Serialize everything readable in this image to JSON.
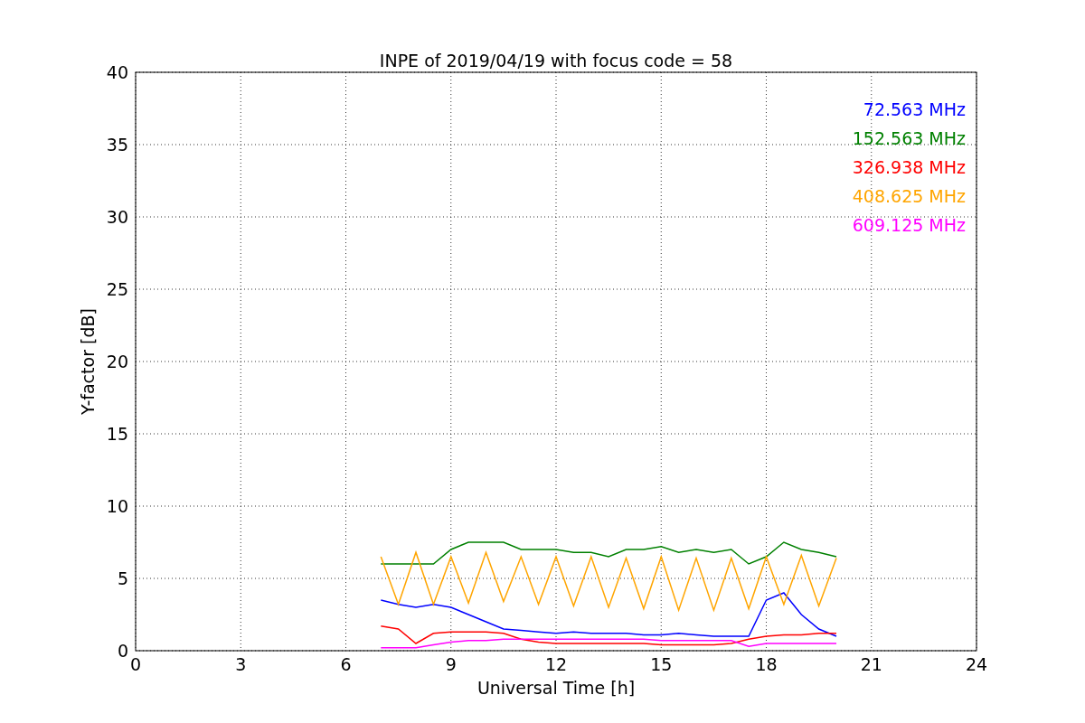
{
  "chart": {
    "chart_data": {
      "type": "line",
      "title": "INPE of 2019/04/19 with focus code = 58",
      "xlabel": "Universal Time [h]",
      "ylabel": "Y-factor [dB]",
      "x": [
        7,
        7.5,
        8,
        8.5,
        9,
        9.5,
        10,
        10.5,
        11,
        11.5,
        12,
        12.5,
        13,
        13.5,
        14,
        14.5,
        15,
        15.5,
        16,
        16.5,
        17,
        17.5,
        18,
        18.5,
        19,
        19.5,
        20
      ],
      "series": [
        {
          "name": "72.563 MHz",
          "color": "#0000ff",
          "values": [
            3.5,
            3.2,
            3,
            3.2,
            3,
            2.5,
            2,
            1.5,
            1.4,
            1.3,
            1.2,
            1.3,
            1.2,
            1.2,
            1.2,
            1.1,
            1.1,
            1.2,
            1.1,
            1,
            1,
            1,
            3.5,
            4,
            2.5,
            1.5,
            1
          ]
        },
        {
          "name": "152.563 MHz",
          "color": "#008000",
          "values": [
            6,
            6,
            6,
            6,
            7,
            7.5,
            7.5,
            7.5,
            7,
            7,
            7,
            6.8,
            6.8,
            6.5,
            7,
            7,
            7.2,
            6.8,
            7,
            6.8,
            7,
            6,
            6.5,
            7.5,
            7,
            6.8,
            6.5
          ]
        },
        {
          "name": "326.938 MHz",
          "color": "#ff0000",
          "values": [
            1.7,
            1.5,
            0.5,
            1.2,
            1.3,
            1.3,
            1.3,
            1.2,
            0.8,
            0.6,
            0.5,
            0.5,
            0.5,
            0.5,
            0.5,
            0.5,
            0.4,
            0.4,
            0.4,
            0.4,
            0.5,
            0.8,
            1,
            1.1,
            1.1,
            1.2,
            1.2
          ]
        },
        {
          "name": "408.625 MHz",
          "color": "#ffa500",
          "values": [
            6.5,
            3.2,
            6.8,
            3.2,
            6.5,
            3.3,
            6.8,
            3.4,
            6.5,
            3.2,
            6.5,
            3.1,
            6.5,
            3,
            6.4,
            2.9,
            6.5,
            2.8,
            6.4,
            2.8,
            6.4,
            2.9,
            6.5,
            3.2,
            6.6,
            3.1,
            6.4
          ]
        },
        {
          "name": "609.125 MHz",
          "color": "#ff00ff",
          "values": [
            0.2,
            0.2,
            0.2,
            0.4,
            0.6,
            0.7,
            0.7,
            0.8,
            0.8,
            0.8,
            0.8,
            0.8,
            0.8,
            0.8,
            0.8,
            0.8,
            0.7,
            0.7,
            0.7,
            0.7,
            0.7,
            0.3,
            0.5,
            0.5,
            0.5,
            0.5,
            0.5
          ]
        }
      ],
      "xlim": [
        0,
        24
      ],
      "ylim": [
        0,
        40
      ],
      "xticks": [
        0,
        3,
        6,
        9,
        12,
        15,
        18,
        21,
        24
      ],
      "yticks": [
        0,
        5,
        10,
        15,
        20,
        25,
        30,
        35,
        40
      ],
      "grid": true
    }
  }
}
